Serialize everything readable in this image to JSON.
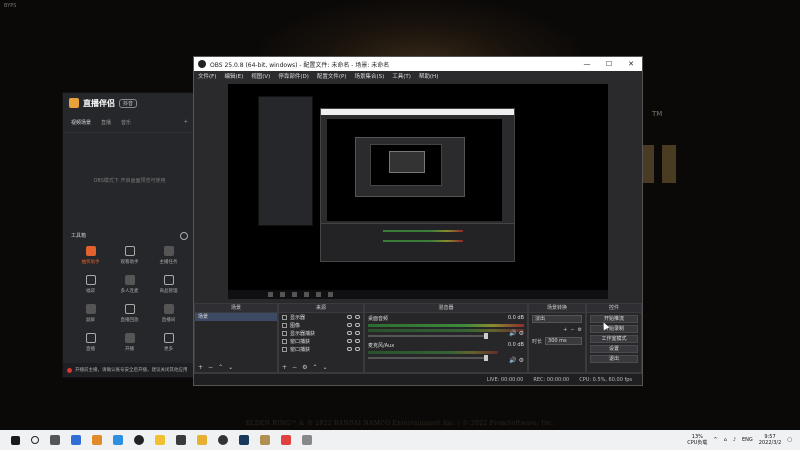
{
  "desktop": {
    "corner_label": "BYPS",
    "copyright": "ELDEN RING™ & © 2022 BANDAI NAMCO Entertainment Inc. / © 2022 FromSoftware, Inc.",
    "trademark": "TM"
  },
  "assistant": {
    "brand": "直播伴侣",
    "badge": "抖音",
    "tabs": [
      "视频场景",
      "直播",
      "音乐"
    ],
    "empty_hint": "OBS模式下 开启画面预览可使用",
    "tools_title": "工具箱",
    "tools": [
      {
        "label": "抽奖助手",
        "highlight": true,
        "icon": "gift-icon"
      },
      {
        "label": "观看助手",
        "highlight": false,
        "icon": "viewer-icon"
      },
      {
        "label": "主播任务",
        "highlight": false,
        "icon": "task-icon"
      },
      {
        "label": "福袋",
        "highlight": false,
        "icon": "bag-icon"
      },
      {
        "label": "多人连麦",
        "highlight": false,
        "icon": "mic-icon"
      },
      {
        "label": "商品管理",
        "highlight": false,
        "icon": "shop-icon"
      },
      {
        "label": "副屏",
        "highlight": false,
        "icon": "screen-icon"
      },
      {
        "label": "直播回放",
        "highlight": false,
        "icon": "replay-icon"
      },
      {
        "label": "直播间",
        "highlight": false,
        "icon": "room-icon"
      },
      {
        "label": "直播",
        "highlight": false,
        "icon": "live-icon"
      },
      {
        "label": "开播",
        "highlight": false,
        "icon": "start-icon"
      },
      {
        "label": "更多",
        "highlight": false,
        "icon": "more-icon"
      }
    ],
    "footer": "开播前主播，请确认账号安全后开播，建议关闭其他应用"
  },
  "obs": {
    "title": "OBS 25.0.8 (64-bit, windows) - 配置文件: 未命名 - 场景: 未命名",
    "menu": [
      "文件(F)",
      "编辑(E)",
      "视图(V)",
      "停靠部件(D)",
      "配置文件(P)",
      "场景集合(S)",
      "工具(T)",
      "帮助(H)"
    ],
    "docks": {
      "scenes": {
        "title": "场景",
        "items": [
          "场景"
        ]
      },
      "sources": {
        "title": "来源",
        "items": [
          "显示器",
          "图像",
          "显示器捕获",
          "窗口捕获",
          "窗口捕获"
        ]
      },
      "mixer": {
        "title": "混音器",
        "channels": [
          {
            "name": "桌面音频",
            "level": "0.0 dB"
          },
          {
            "name": "麦克风/Aux",
            "level": "0.0 dB"
          }
        ]
      },
      "transitions": {
        "title": "场景转换",
        "type": "淡出",
        "duration_label": "时长",
        "duration_value": "300 ms"
      },
      "controls": {
        "title": "控件",
        "buttons": [
          "开始推流",
          "开始录制",
          "工作室模式",
          "设置",
          "退出"
        ]
      }
    },
    "status": {
      "live": "LIVE: 00:00:00",
      "rec": "REC: 00:00:00",
      "cpu": "CPU: 0.5%, 60.00 fps"
    }
  },
  "taskbar": {
    "cpu_percent": "13%",
    "cpu_label": "CPU负载",
    "lang": "ENG",
    "time": "9:57",
    "date": "2022/3/2"
  }
}
